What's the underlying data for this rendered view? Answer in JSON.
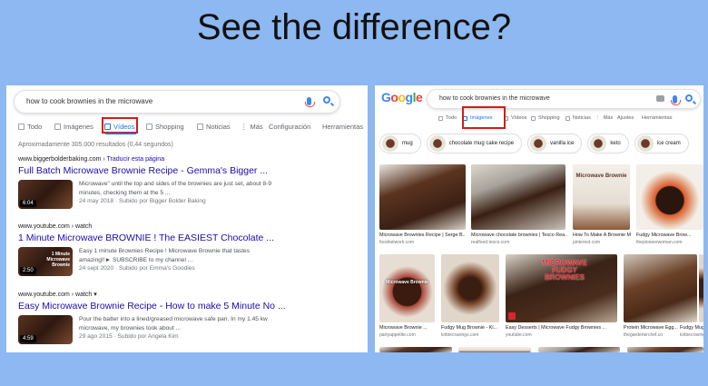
{
  "title": "See the difference?",
  "left": {
    "query": "how to cook brownies in the microwave",
    "tabs": [
      "Todo",
      "Imágenes",
      "Vídeos",
      "Shopping",
      "Noticias",
      "Más",
      "Configuración",
      "Herramientas"
    ],
    "stats": "Aproximadamente 305.000 resultados (0,44 segundos)",
    "results": [
      {
        "url": "www.biggerbolderbaking.com",
        "translate": "› Traducir esta página",
        "title": "Full Batch Microwave Brownie Recipe - Gemma's Bigger ...",
        "duration": "6:04",
        "snippet1": "Microwave\" until the top and sides of the brownies are just set, about 8-9",
        "snippet2": "minutes, checking them at the 5 ...",
        "meta": "24 may 2018 · Subido por Bigger Bolder Baking"
      },
      {
        "url": "www.youtube.com › watch",
        "title": "1 Minute Microwave BROWNIE ! The EASIEST Chocolate ...",
        "duration": "2:50",
        "thumb_caption": "1 Minute\nMicrowave\nBrownie",
        "snippet1": "Easy 1 minute Brownies Recipe ! Microwave Brownie that tastes",
        "snippet2": "amazing!!► SUBSCRIBE to my channel ...",
        "meta": "24 sept 2020 · Subido por Emma's Goodies"
      },
      {
        "url": "www.youtube.com › watch",
        "title": "Easy Microwave Brownie Recipe - How to make 5 Minute No ...",
        "duration": "4:59",
        "snippet1": "Pour the batter into a lined/greased microwave safe pan. In my 1.45 kw",
        "snippet2": "microwave, my brownies took about ...",
        "meta": "29 ago 2015 · Subido por Angela Kim"
      }
    ]
  },
  "right": {
    "logo": "Google",
    "query": "how to cook brownies in the microwave",
    "tabs": [
      "Todo",
      "Imágenes",
      "Vídeos",
      "Shopping",
      "Noticias",
      "Más",
      "Ajustes",
      "Herramientas"
    ],
    "chips": [
      "mug",
      "chocolate mug cake recipe",
      "vanilla ice",
      "keto",
      "ice cream"
    ],
    "images": [
      {
        "caption": "Microwave Brownies Recipe | Serge B...",
        "source": "foodnetwork.com"
      },
      {
        "caption": "Microwave chocolate brownies | Tesco Rea...",
        "source": "realfood.tesco.com"
      },
      {
        "caption": "How To Make A Brownie Mi...",
        "source": "pinterest.com",
        "overlay": "Microwave Brownie"
      },
      {
        "caption": "Fudgy Microwave Brow...",
        "source": "thepioneerwoman.com"
      },
      {
        "caption": "Microwave Brownie ...",
        "source": "partyappetite.com",
        "overlay": "Microwave Brownie"
      },
      {
        "caption": "Fudgy Mug Brownie - Ki...",
        "source": "kirbiecravings.com"
      },
      {
        "caption": "Easy Desserts | Microwave Fudgy Brownies ...",
        "source": "youtube.com",
        "overlay": "MICROWAVE FUDGY BROWNIES"
      },
      {
        "caption": "Protein Microwave Egg...",
        "source": "thegardenerchef.co"
      },
      {
        "caption": "Fudgy Mug Brownie ...",
        "source": "kirbiecravings.com"
      }
    ]
  }
}
